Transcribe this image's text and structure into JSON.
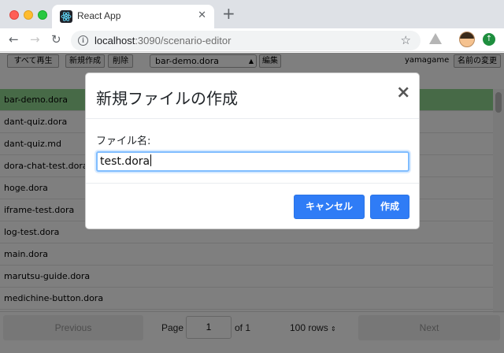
{
  "browser": {
    "tab_title": "React App",
    "tab_close": "✕",
    "new_tab": "+",
    "url_host": "localhost",
    "url_path": ":3090/scenario-editor",
    "colors": {
      "tabbar": "#dee1e6",
      "traffic_close": "#ff5f57",
      "traffic_min": "#febc2e",
      "traffic_max": "#28c840"
    }
  },
  "app": {
    "toolbar": {
      "play_all": "すべて再生",
      "new_file": "新規作成",
      "delete": "削除",
      "selected_file": "bar-demo.dora",
      "edit": "編集",
      "username": "yamagame",
      "rename": "名前の変更"
    },
    "files": [
      {
        "name": "bar-demo.dora",
        "selected": true
      },
      {
        "name": "dant-quiz.dora",
        "selected": false
      },
      {
        "name": "dant-quiz.md",
        "selected": false
      },
      {
        "name": "dora-chat-test.dora",
        "selected": false
      },
      {
        "name": "hoge.dora",
        "selected": false
      },
      {
        "name": "iframe-test.dora",
        "selected": false
      },
      {
        "name": "log-test.dora",
        "selected": false
      },
      {
        "name": "main.dora",
        "selected": false
      },
      {
        "name": "marutsu-guide.dora",
        "selected": false
      },
      {
        "name": "medichine-button.dora",
        "selected": false
      }
    ],
    "pager": {
      "previous": "Previous",
      "page_label": "Page",
      "page_value": "1",
      "of_label": "of 1",
      "rows": "100 rows",
      "next": "Next"
    }
  },
  "modal": {
    "title": "新規ファイルの作成",
    "close": "×",
    "field_label": "ファイル名:",
    "field_value": "test.dora",
    "cancel": "キャンセル",
    "create": "作成",
    "accent": "#2f7cf6"
  }
}
